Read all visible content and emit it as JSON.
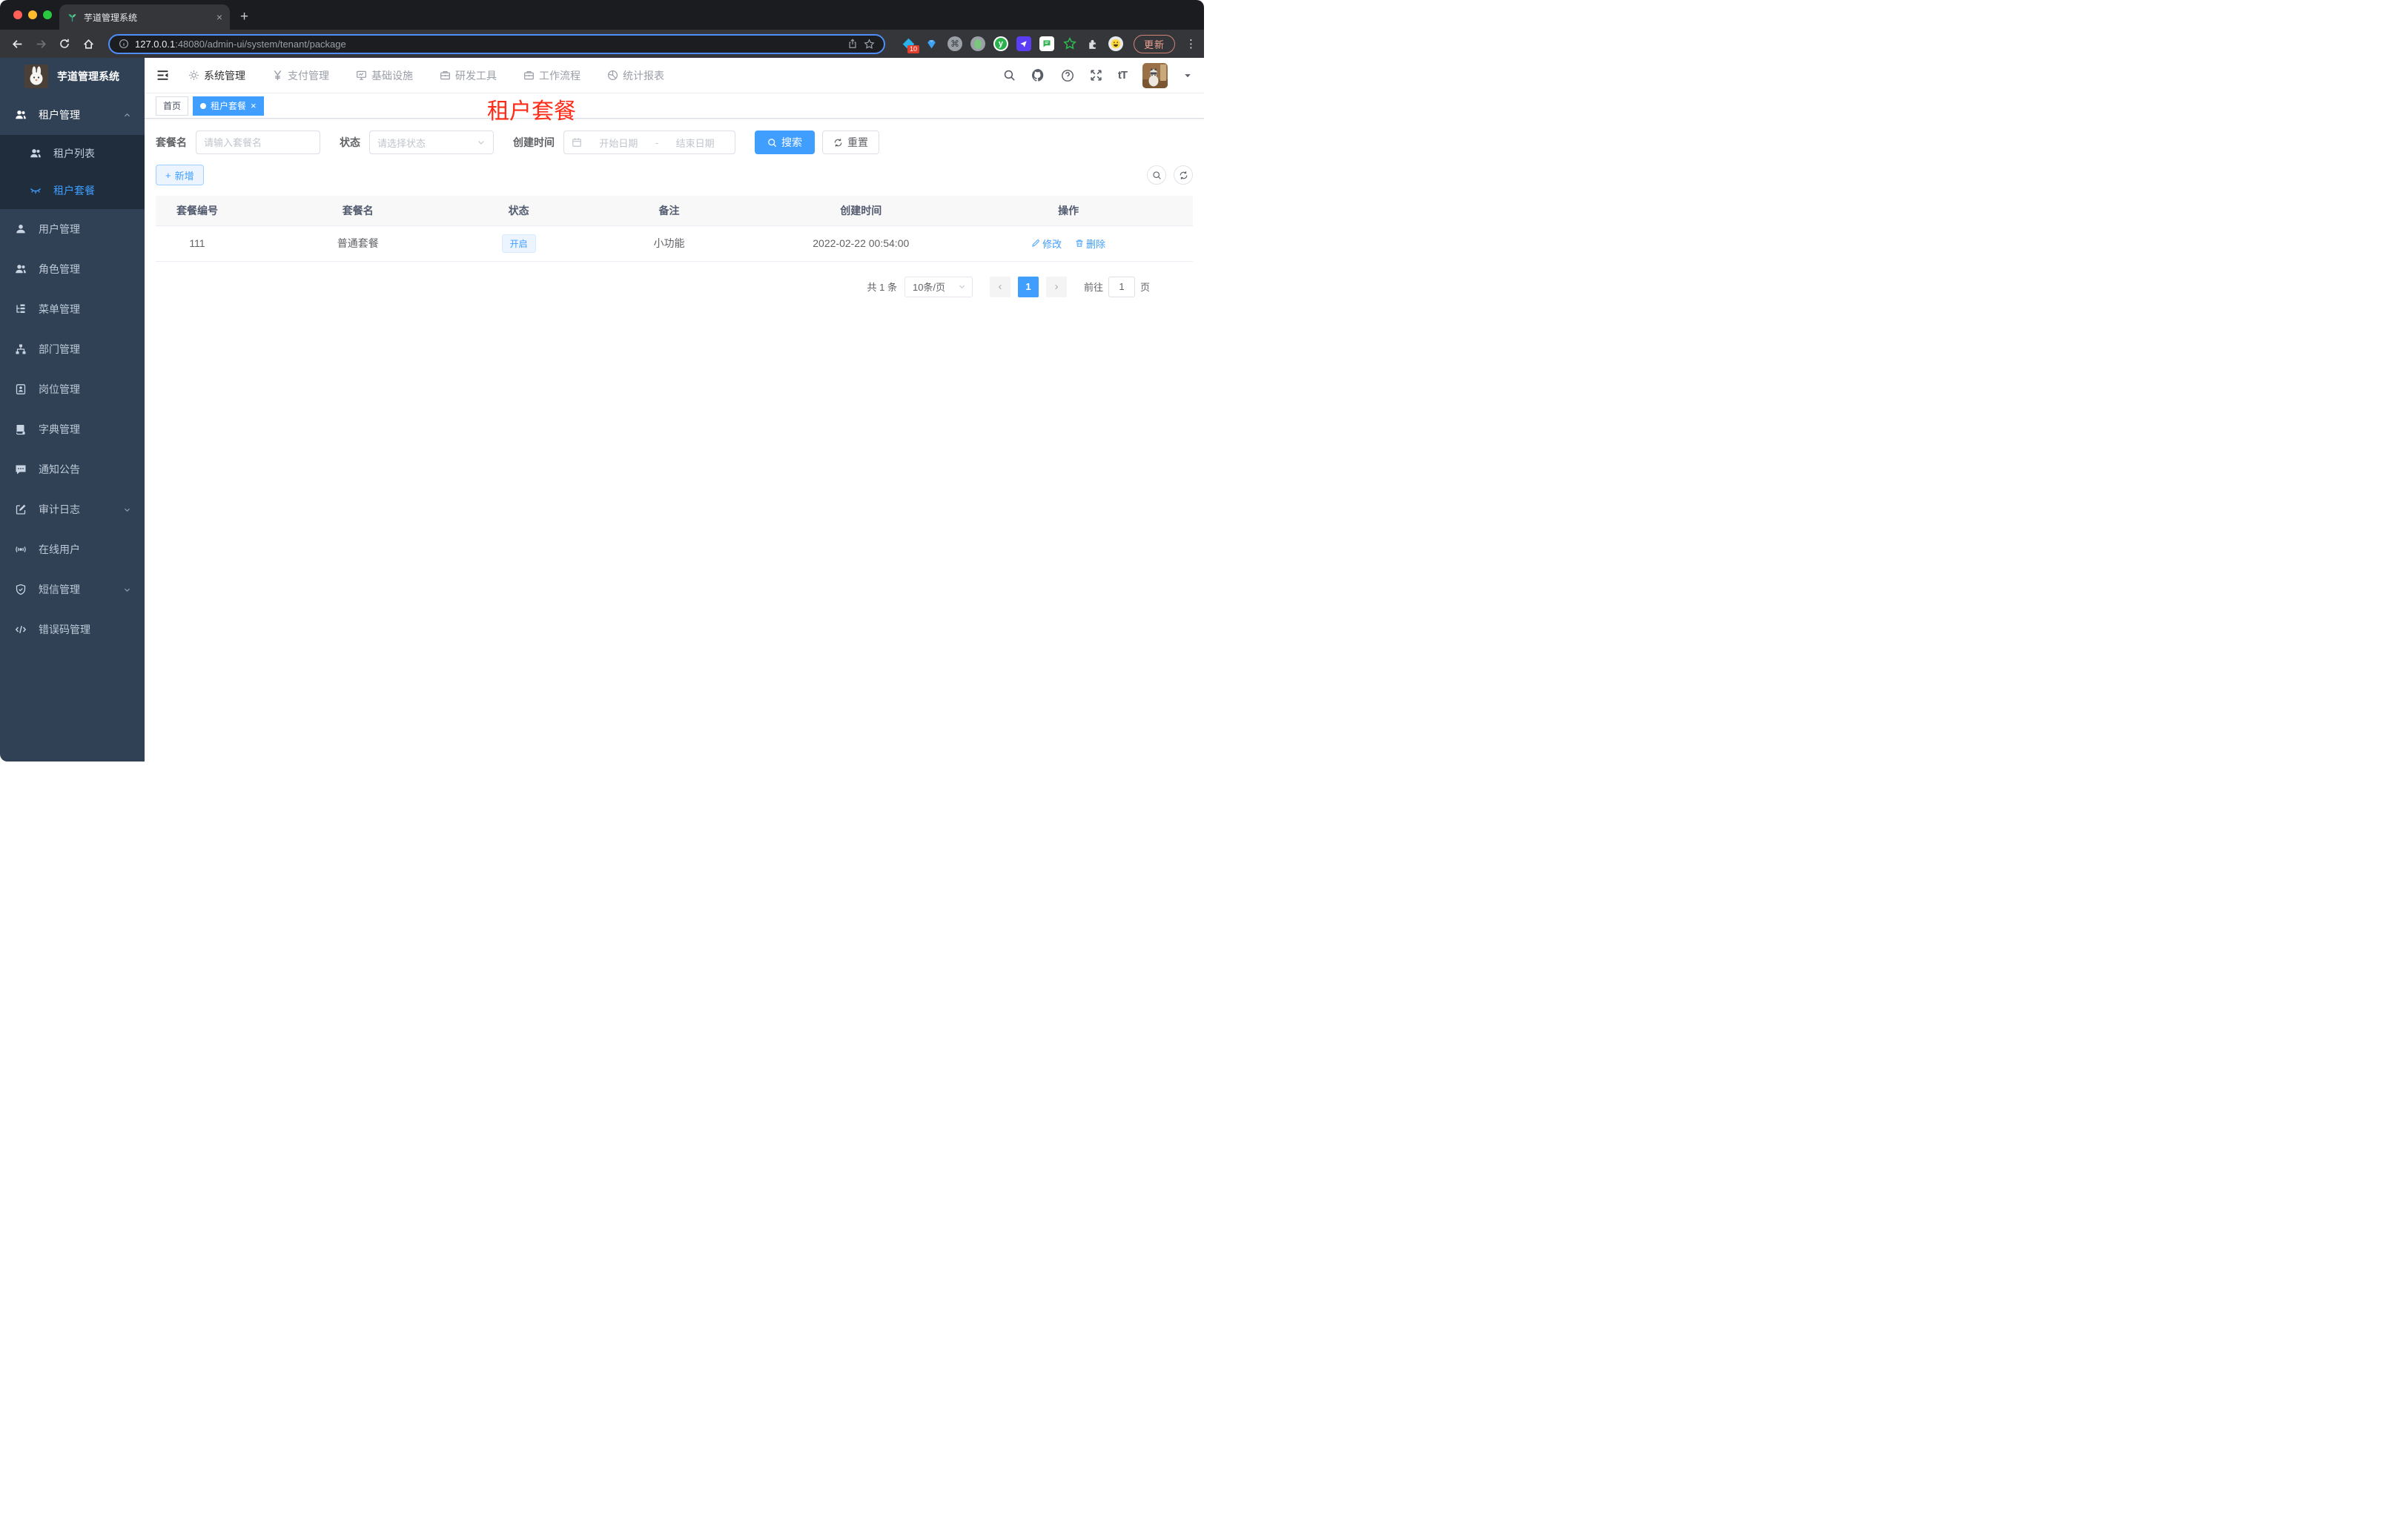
{
  "browser": {
    "tab_title": "芋道管理系统",
    "close_glyph": "×",
    "new_tab_glyph": "+",
    "url_host": "127.0.0.1",
    "url_rest": ":48080/admin-ui/system/tenant/package",
    "extensions_badge": "10",
    "cmd_glyph": "⌘",
    "ext_y_glyph": "y",
    "update_label": "更新",
    "kebab_glyph": "⋮"
  },
  "header": {
    "nav": [
      {
        "label": "系统管理"
      },
      {
        "label": "支付管理"
      },
      {
        "label": "基础设施"
      },
      {
        "label": "研发工具"
      },
      {
        "label": "工作流程"
      },
      {
        "label": "统计报表"
      }
    ],
    "font_size_glyph": "tT"
  },
  "sidebar": {
    "logo_title": "芋道管理系统",
    "items": [
      {
        "label": "租户管理"
      },
      {
        "label": "租户列表"
      },
      {
        "label": "租户套餐"
      },
      {
        "label": "用户管理"
      },
      {
        "label": "角色管理"
      },
      {
        "label": "菜单管理"
      },
      {
        "label": "部门管理"
      },
      {
        "label": "岗位管理"
      },
      {
        "label": "字典管理"
      },
      {
        "label": "通知公告"
      },
      {
        "label": "审计日志"
      },
      {
        "label": "在线用户"
      },
      {
        "label": "短信管理"
      },
      {
        "label": "错误码管理"
      }
    ]
  },
  "tags": {
    "home": "首页",
    "active": "租户套餐",
    "close_glyph": "×"
  },
  "page": {
    "red_title": "租户套餐"
  },
  "filters": {
    "name_label": "套餐名",
    "name_placeholder": "请输入套餐名",
    "status_label": "状态",
    "status_placeholder": "请选择状态",
    "date_label": "创建时间",
    "date_start": "开始日期",
    "date_sep": "-",
    "date_end": "结束日期",
    "search_label": "搜索",
    "reset_label": "重置"
  },
  "toolbar": {
    "add_label": "新增",
    "plus_glyph": "+"
  },
  "table": {
    "headers": [
      "套餐编号",
      "套餐名",
      "状态",
      "备注",
      "创建时间",
      "操作"
    ],
    "rows": [
      {
        "id": "111",
        "name": "普通套餐",
        "status": "开启",
        "remark": "小功能",
        "created": "2022-02-22 00:54:00",
        "edit_label": "修改",
        "delete_label": "删除"
      }
    ]
  },
  "pagination": {
    "total": "共 1 条",
    "page_size": "10条/页",
    "prev_glyph": "‹",
    "current": "1",
    "next_glyph": "›",
    "goto_label": "前往",
    "goto_value": "1",
    "unit_label": "页"
  },
  "colors": {
    "accent": "#409eff",
    "sidebar_bg": "#304156",
    "submenu_bg": "#1f2d3d",
    "red_title": "#fe2c17",
    "status_tag_bg": "#ecf5ff",
    "tag_active_bg": "#409eff",
    "update_button_text": "#f0a293"
  }
}
